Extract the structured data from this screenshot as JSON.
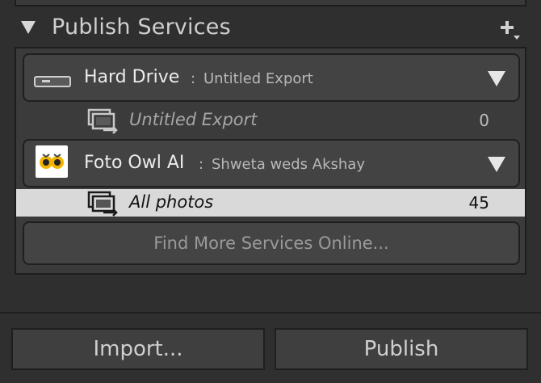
{
  "panel": {
    "title": "Publish Services",
    "add_icon": "plus-with-dropdown-icon"
  },
  "services": [
    {
      "icon": "hard-drive-icon",
      "name": "Hard Drive",
      "separator": ":",
      "subtitle": "Untitled Export",
      "collection": {
        "icon": "published-collection-icon",
        "name": "Untitled Export",
        "count": "0",
        "selected": false
      }
    },
    {
      "icon": "foto-owl-logo-icon",
      "name": "Foto Owl AI",
      "separator": ":",
      "subtitle": "Shweta weds Akshay",
      "collection": {
        "icon": "published-collection-icon",
        "name": "All photos",
        "count": "45",
        "selected": true
      }
    }
  ],
  "find_more_label": "Find More Services Online...",
  "buttons": {
    "import_label": "Import...",
    "publish_label": "Publish"
  },
  "colors": {
    "background": "#2f2f2f",
    "selected_row": "#d9d9d9",
    "owl_eyes": "#f2b400"
  }
}
